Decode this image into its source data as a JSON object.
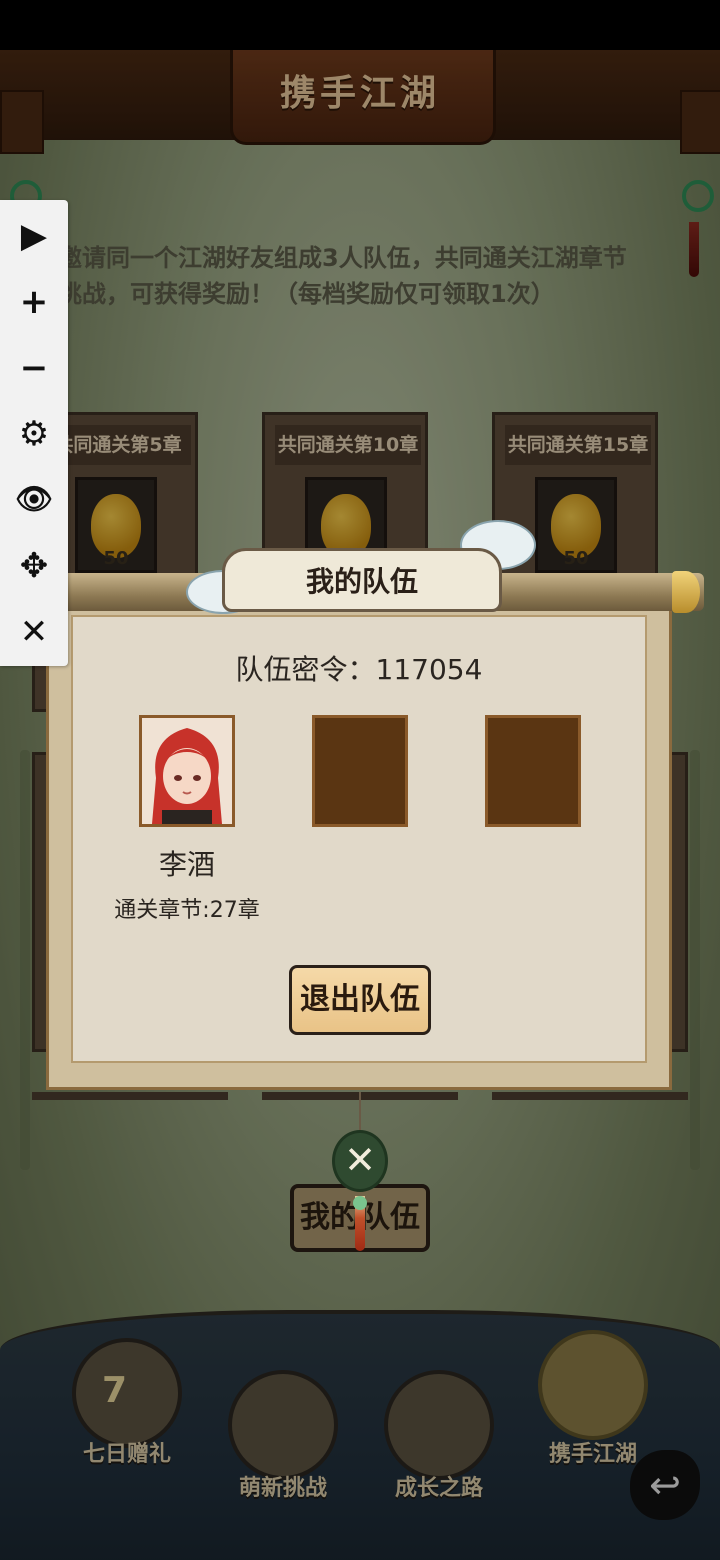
{
  "screen_title": "携手江湖",
  "intro": {
    "line1": "邀请同一个江湖好友组成3人队伍，共同通关江湖章节",
    "line2": "挑战，可获得奖励！（每档奖励仅可领取1次）"
  },
  "reward_cards": [
    {
      "label": "共同通关第5章",
      "amount": "50"
    },
    {
      "label": "共同通关第10章",
      "amount": "50"
    },
    {
      "label": "共同通关第15章",
      "amount": "50"
    }
  ],
  "dialog": {
    "title": "我的队伍",
    "team_code": "队伍密令：117054",
    "member": {
      "name": "李酒",
      "chapter": "通关章节:27章"
    },
    "leave_label": "退出队伍"
  },
  "my_team_button": "我的队伍",
  "bottom_nav": [
    {
      "label": "七日赠礼",
      "badge": "7"
    },
    {
      "label": "萌新挑战"
    },
    {
      "label": "成长之路"
    },
    {
      "label": "携手江湖"
    }
  ],
  "toolbar": {
    "icons": [
      "play-icon",
      "zoom-in-icon",
      "zoom-out-icon",
      "gear-icon",
      "eye-icon",
      "move-icon",
      "close-icon"
    ],
    "glyphs": [
      "▶",
      "+",
      "−",
      "⚙",
      "👁",
      "✥",
      "✕"
    ]
  },
  "colors": {
    "accent_gold": "#f2c84a",
    "wood_dark": "#4a2a14",
    "jade": "#2f8a55"
  }
}
